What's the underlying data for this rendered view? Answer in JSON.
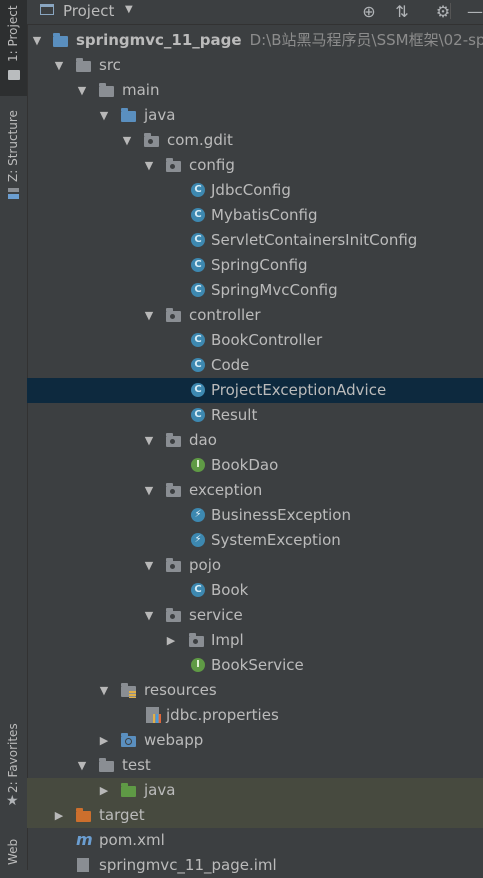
{
  "side_tabs": {
    "project": "1: Project",
    "structure": "Z: Structure",
    "favorites": "2: Favorites",
    "web": "Web"
  },
  "header": {
    "title": "Project",
    "icons": [
      "locate-icon",
      "collapse-icon",
      "gear-icon",
      "hide-icon"
    ]
  },
  "colors": {
    "background": "#3c3f41",
    "selection": "#0d293e",
    "highlight": "#474a3f",
    "class_icon": "#3d88b0",
    "interface_icon": "#5f9a45",
    "folder_blue": "#5a8fbf",
    "folder_green": "#5f9a45",
    "folder_orange": "#cc6f2d"
  },
  "tree": {
    "root": {
      "label": "springmvc_11_page",
      "path": "D:\\B站黑马程序员\\SSM框架\\02-sprin"
    },
    "src": "src",
    "main": "main",
    "java": "java",
    "package": "com.gdit",
    "config": "config",
    "config_items": [
      "JdbcConfig",
      "MybatisConfig",
      "ServletContainersInitConfig",
      "SpringConfig",
      "SpringMvcConfig"
    ],
    "controller": "controller",
    "controller_items": [
      "BookController",
      "Code",
      "ProjectExceptionAdvice",
      "Result"
    ],
    "dao": "dao",
    "dao_items": [
      "BookDao"
    ],
    "exception": "exception",
    "exception_items": [
      "BusinessException",
      "SystemException"
    ],
    "pojo": "pojo",
    "pojo_items": [
      "Book"
    ],
    "service": "service",
    "service_impl": "Impl",
    "service_items": [
      "BookService"
    ],
    "resources": "resources",
    "jdbc_properties": "jdbc.properties",
    "webapp": "webapp",
    "test": "test",
    "test_java": "java",
    "target": "target",
    "pom": "pom.xml",
    "iml": "springmvc_11_page.iml"
  }
}
